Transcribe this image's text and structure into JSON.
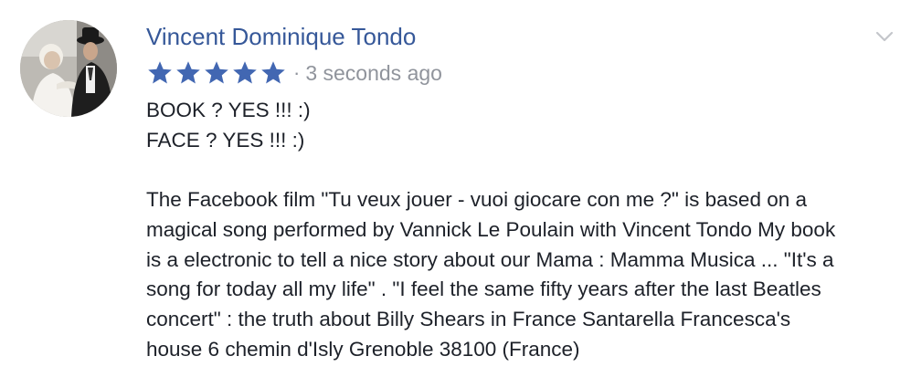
{
  "review": {
    "author": "Vincent Dominique Tondo",
    "rating": 5,
    "rating_max": 5,
    "separator": "·",
    "timestamp": "3 seconds ago",
    "star_color": "#4267b2",
    "author_color": "#365899",
    "body_lines": [
      "BOOK ? YES !!! :)",
      "FACE ? YES !!! :)",
      "",
      "The Facebook film \"Tu veux jouer - vuoi giocare con me ?\" is based on a",
      "magical song performed by Vannick Le Poulain with Vincent Tondo My book",
      "is a electronic to tell a nice story about our Mama : Mamma Musica ... \"It's a",
      "song for today all my life\" . \"I feel the same fifty years after the last Beatles",
      "concert\" : the truth about Billy Shears in France Santarella Francesca's",
      "house 6 chemin d'Isly Grenoble 38100 (France)"
    ],
    "avatar_icon": "profile-photo",
    "menu_icon": "chevron-down-icon"
  }
}
